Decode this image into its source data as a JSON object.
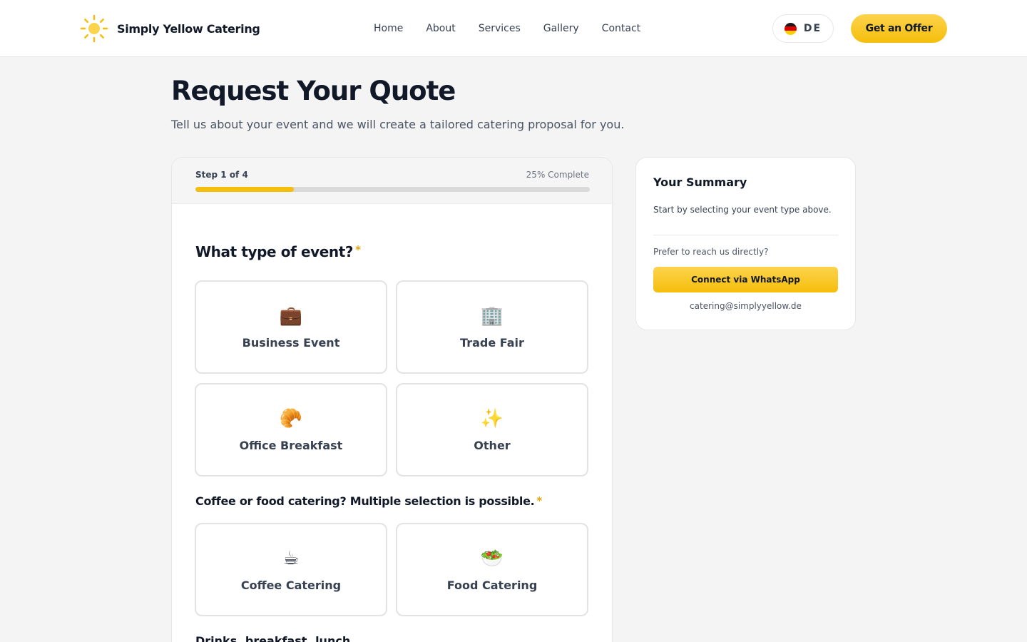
{
  "header": {
    "brand": "Simply Yellow Catering",
    "logo_icon": "sun-icon",
    "nav": [
      {
        "label": "Home"
      },
      {
        "label": "About"
      },
      {
        "label": "Services"
      },
      {
        "label": "Gallery"
      },
      {
        "label": "Contact"
      }
    ],
    "language": {
      "code": "DE",
      "flag_icon": "germany-flag-icon"
    },
    "cta_label": "Get an Offer"
  },
  "page": {
    "title": "Request Your Quote",
    "subtitle": "Tell us about your event and we will create a tailored catering proposal for you."
  },
  "progress": {
    "step_label": "Step 1 of 4",
    "complete_label": "25% Complete",
    "fraction": 0.25
  },
  "form": {
    "event_question": "What type of event?",
    "required_mark": "*",
    "event_options": [
      {
        "emoji": "💼",
        "label": "Business Event",
        "icon": "briefcase-icon"
      },
      {
        "emoji": "🏢",
        "label": "Trade Fair",
        "icon": "office-building-icon"
      },
      {
        "emoji": "🥐",
        "label": "Office Breakfast",
        "icon": "croissant-icon"
      },
      {
        "emoji": "✨",
        "label": "Other",
        "icon": "sparkles-icon"
      }
    ],
    "catering_question": "Coffee or food catering? Multiple selection is possible.",
    "catering_options": [
      {
        "emoji": "☕",
        "label": "Coffee Catering",
        "icon": "coffee-icon"
      },
      {
        "emoji": "🥗",
        "label": "Food Catering",
        "icon": "salad-icon"
      }
    ],
    "next_question": "Drinks, breakfast, lunch"
  },
  "summary": {
    "title": "Your Summary",
    "text": "Start by selecting your event type above.",
    "prefer_text": "Prefer to reach us directly?",
    "whatsapp_label": "Connect via WhatsApp",
    "email": "catering@simplyyellow.de"
  },
  "colors": {
    "accent": "#f5be0b",
    "accent_light": "#fcd34d",
    "background": "#f4f4f4",
    "text": "#111827"
  }
}
